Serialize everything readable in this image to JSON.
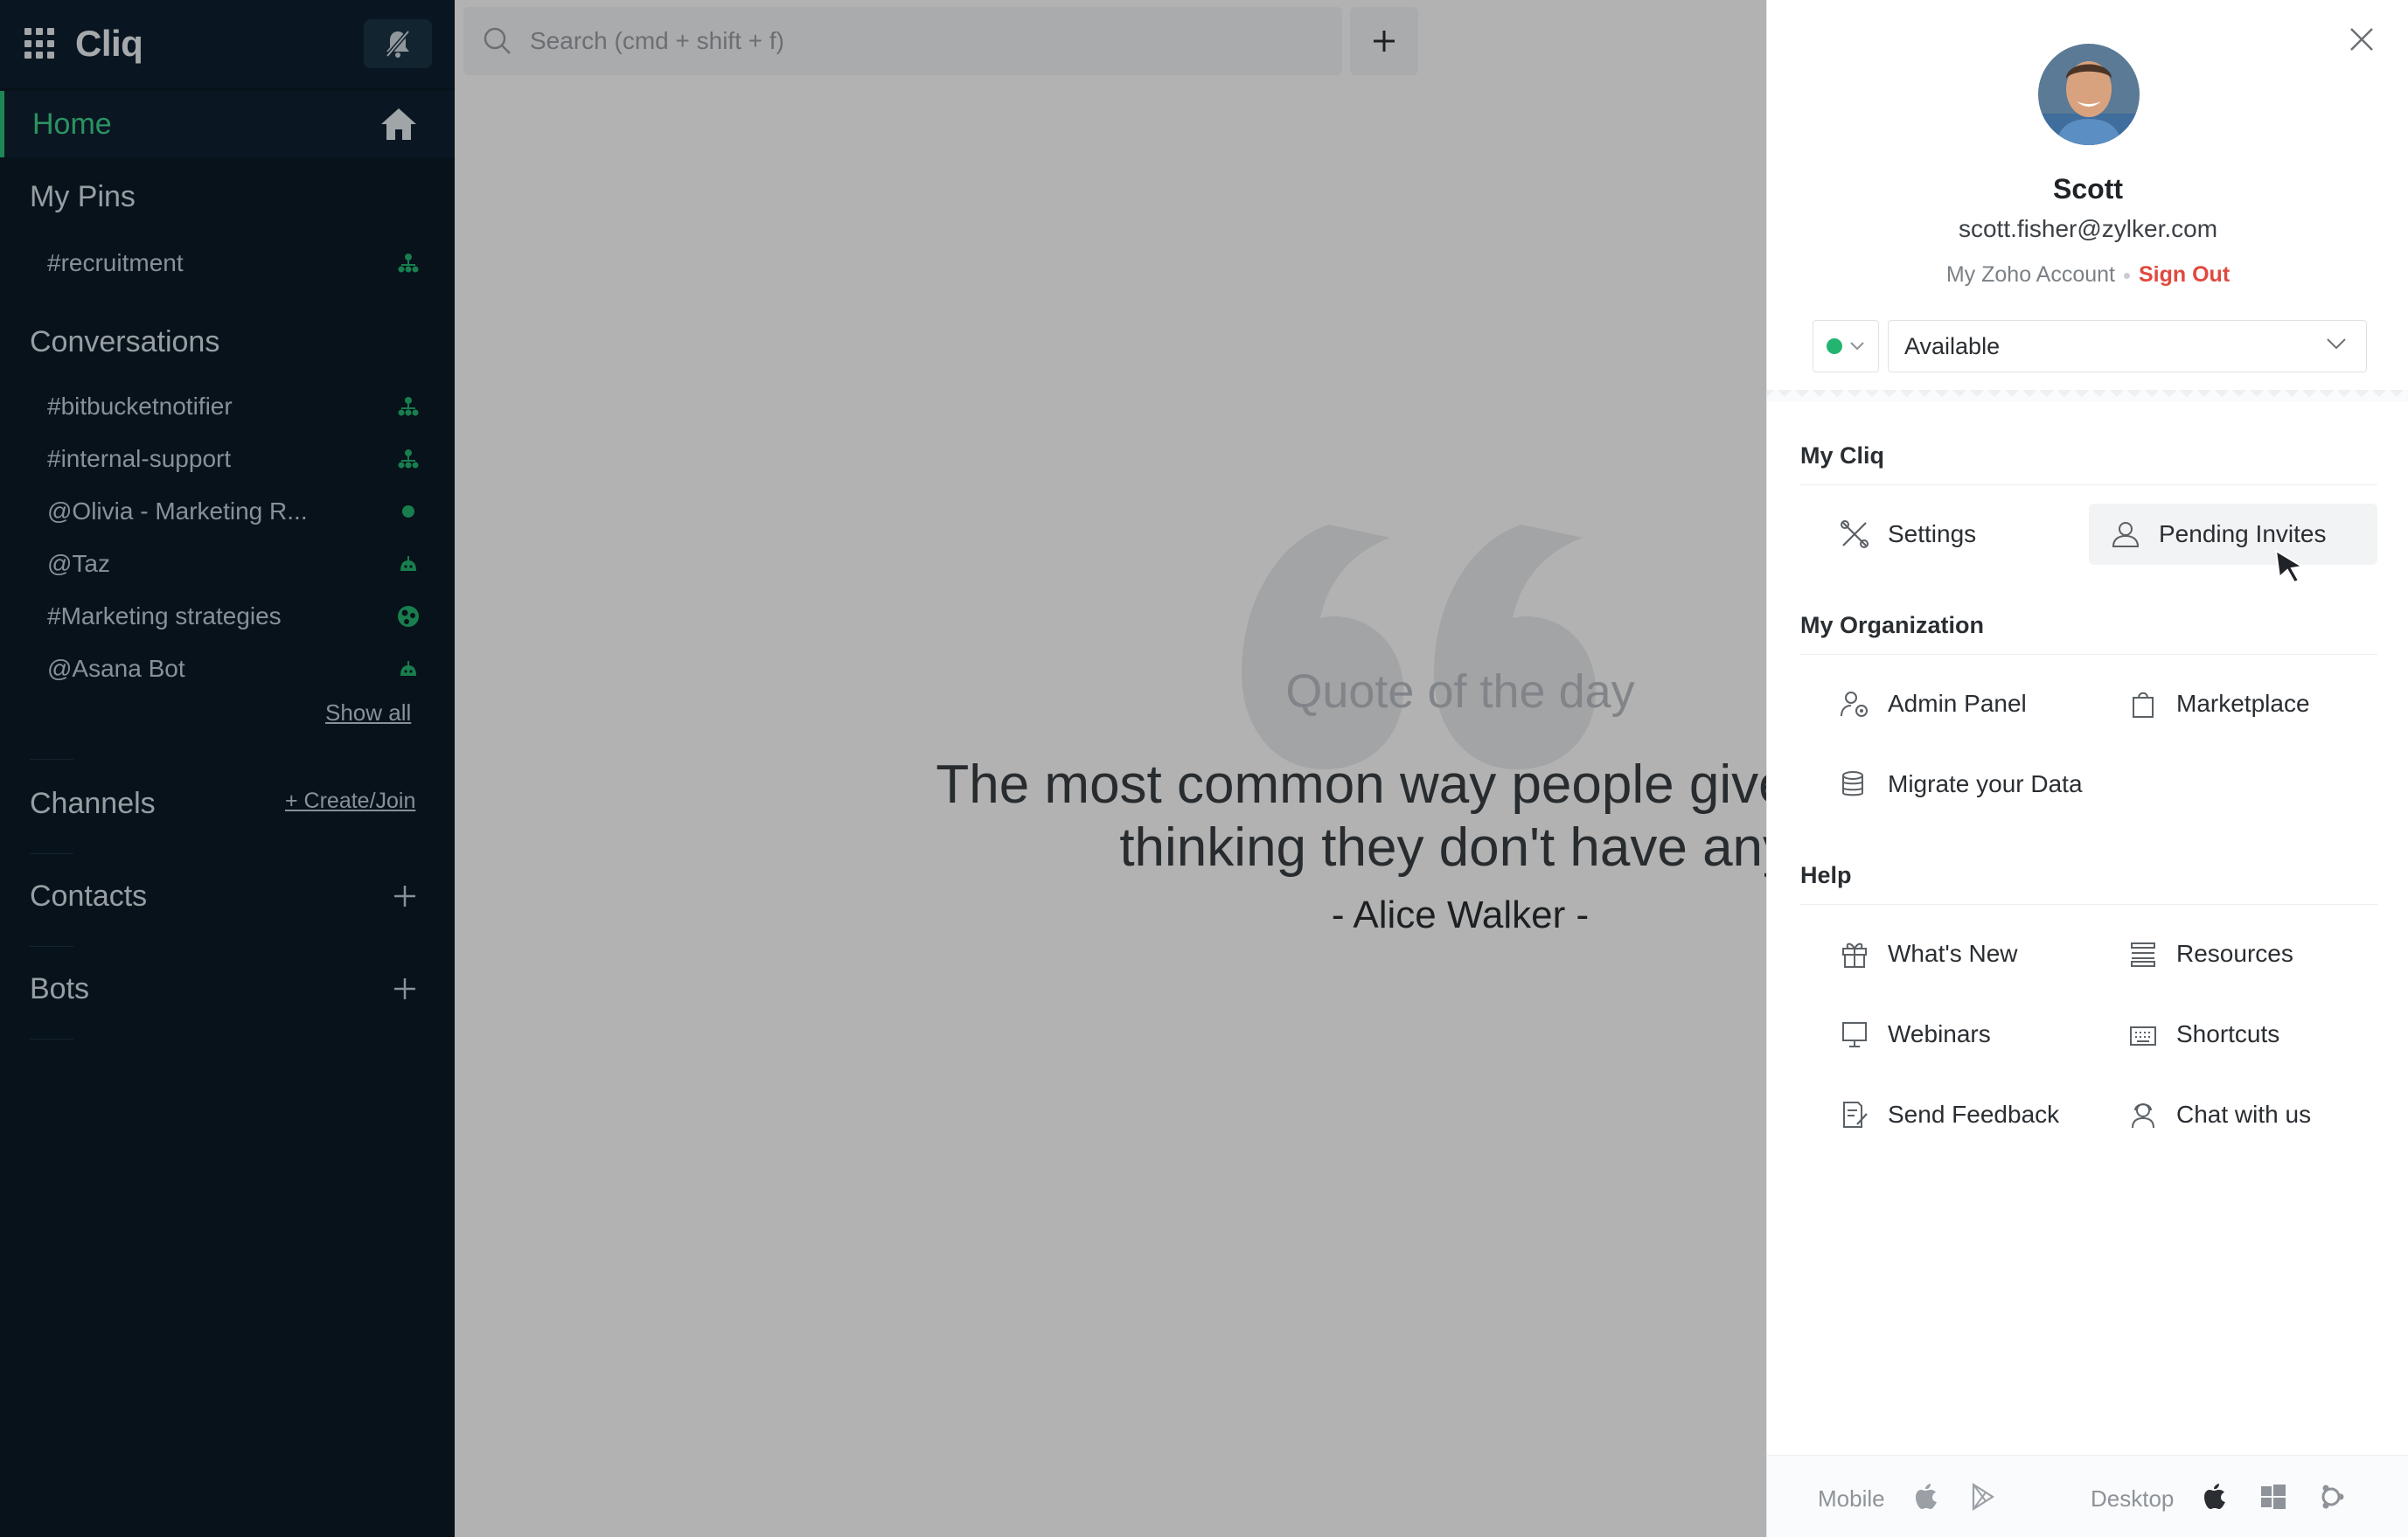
{
  "app": {
    "name": "Cliq"
  },
  "sidebar": {
    "home_label": "Home",
    "pins_title": "My Pins",
    "pins": [
      {
        "label": "#recruitment",
        "status_icon": "channel-org-icon"
      }
    ],
    "conversations_title": "Conversations",
    "conversations": [
      {
        "label": "#bitbucketnotifier",
        "status_icon": "channel-org-icon"
      },
      {
        "label": "#internal-support",
        "status_icon": "channel-org-icon"
      },
      {
        "label": "@Olivia - Marketing R...",
        "status_icon": "online-dot"
      },
      {
        "label": "@Taz",
        "status_icon": "bot-icon"
      },
      {
        "label": "#Marketing strategies",
        "status_icon": "globe-icon"
      },
      {
        "label": "@Asana Bot",
        "status_icon": "bot-icon"
      }
    ],
    "show_all": "Show all",
    "channels_title": "Channels",
    "create_join": "+ Create/Join",
    "contacts_title": "Contacts",
    "bots_title": "Bots"
  },
  "main": {
    "search_placeholder": "Search (cmd + shift + f)",
    "quote_of_day_label": "Quote of the day",
    "quote_line1": "The most common way people give up their",
    "quote_line2": "thinking they don't have any.",
    "quote_author": "- Alice Walker -"
  },
  "profile": {
    "name": "Scott",
    "email": "scott.fisher@zylker.com",
    "account_link": "My Zoho Account",
    "sign_out": "Sign Out",
    "status": "Available",
    "status_color": "#23b56f"
  },
  "menu": {
    "my_cliq_title": "My Cliq",
    "settings": "Settings",
    "pending_invites": "Pending Invites",
    "org_title": "My Organization",
    "admin_panel": "Admin Panel",
    "marketplace": "Marketplace",
    "migrate": "Migrate your Data",
    "help_title": "Help",
    "whats_new": "What's New",
    "resources": "Resources",
    "webinars": "Webinars",
    "shortcuts": "Shortcuts",
    "send_feedback": "Send Feedback",
    "chat_with_us": "Chat with us"
  },
  "footer": {
    "mobile_label": "Mobile",
    "desktop_label": "Desktop"
  },
  "colors": {
    "accent_green": "#3fd18f",
    "sidebar_bg": "#0b1a27",
    "danger": "#e0493f"
  }
}
